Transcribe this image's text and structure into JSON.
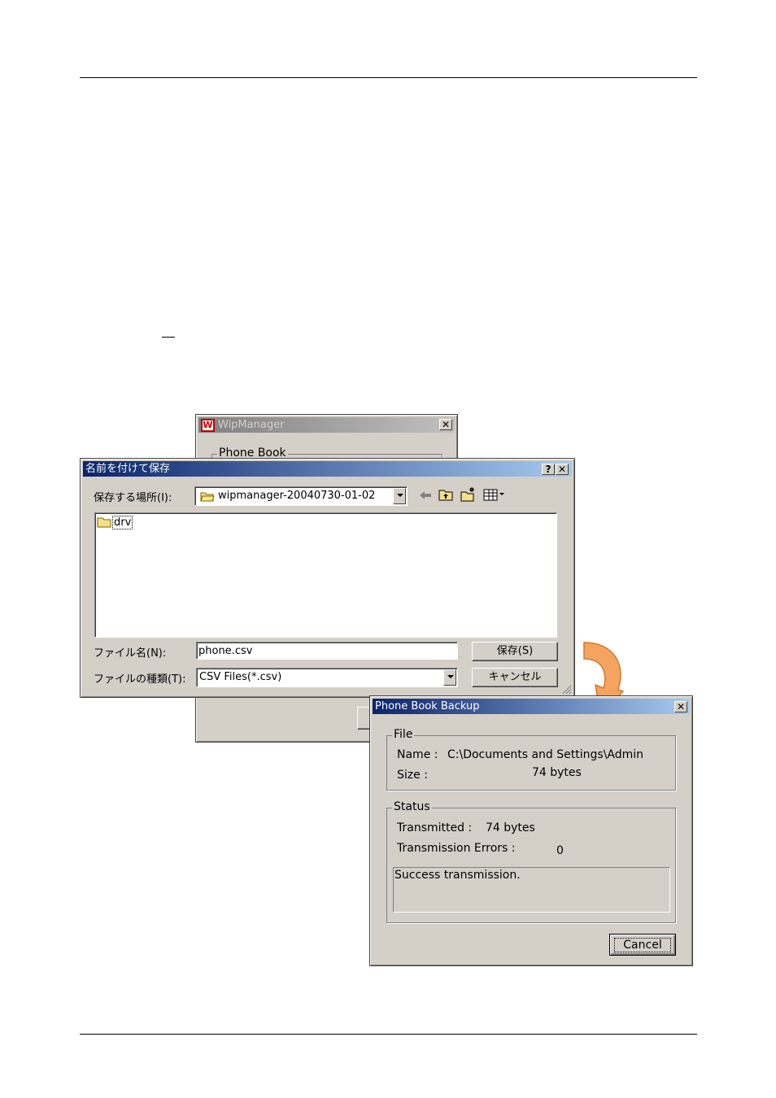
{
  "wip_window": {
    "title": "WipManager",
    "logo_letter": "W",
    "group_label": "Phone Book",
    "close": "✕"
  },
  "save_dialog": {
    "title": "名前を付けて保存",
    "help": "?",
    "close": "✕",
    "location_label": "保存する場所(I):",
    "location_value": "wipmanager-20040730-01-02",
    "files": [
      {
        "name": "drv",
        "icon": "folder-icon"
      }
    ],
    "filename_label": "ファイル名(N):",
    "filename_value": "phone.csv",
    "filetype_label": "ファイルの種類(T):",
    "filetype_value": "CSV Files(*.csv)",
    "save_button": "保存(S)",
    "cancel_button": "キャンセル",
    "toolbar_icons": [
      "back-arrow-icon",
      "up-folder-icon",
      "new-folder-icon",
      "view-menu-icon"
    ]
  },
  "backup_dialog": {
    "title": "Phone Book Backup",
    "close": "✕",
    "file_group": "File",
    "name_label": "Name :",
    "name_value": "C:\\Documents and Settings\\Admin",
    "size_label": "Size :",
    "size_value": "74 bytes",
    "status_group": "Status",
    "transmitted_label": "Transmitted :",
    "transmitted_value": "74 bytes",
    "errors_label": "Transmission Errors :",
    "errors_value": "0",
    "message": "Success transmission.",
    "cancel_button": "Cancel"
  },
  "colors": {
    "titlebar_active": "#0a246a",
    "window_face": "#d4d0c8",
    "arrow": "#f4a460"
  }
}
